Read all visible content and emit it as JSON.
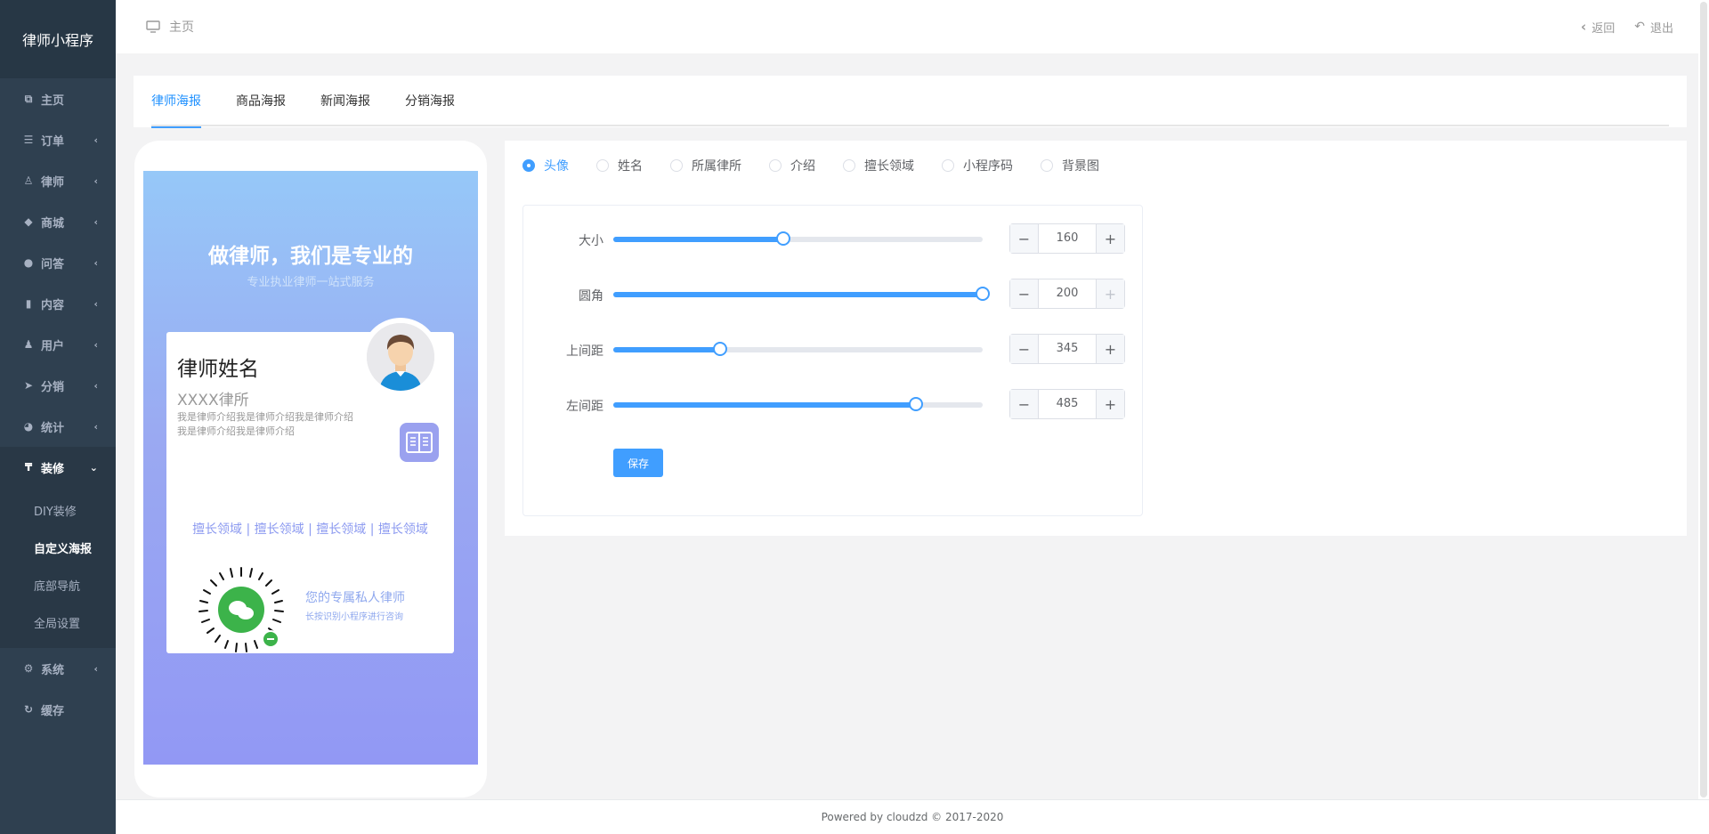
{
  "app": {
    "title": "律师小程序"
  },
  "sidebar": {
    "items": [
      {
        "label": "主页",
        "icon": "copy-icon"
      },
      {
        "label": "订单",
        "icon": "list-icon"
      },
      {
        "label": "律师",
        "icon": "user-icon"
      },
      {
        "label": "商城",
        "icon": "tags-icon"
      },
      {
        "label": "问答",
        "icon": "comment-icon"
      },
      {
        "label": "内容",
        "icon": "book-icon"
      },
      {
        "label": "用户",
        "icon": "person-icon"
      },
      {
        "label": "分销",
        "icon": "send-icon"
      },
      {
        "label": "统计",
        "icon": "pie-chart-icon"
      },
      {
        "label": "装修",
        "icon": "paint-icon"
      },
      {
        "label": "系统",
        "icon": "gear-icon"
      },
      {
        "label": "缓存",
        "icon": "refresh-icon"
      }
    ],
    "sub_items": [
      {
        "label": "DIY装修"
      },
      {
        "label": "自定义海报"
      },
      {
        "label": "底部导航"
      },
      {
        "label": "全局设置"
      }
    ]
  },
  "header": {
    "breadcrumb": "主页",
    "back_label": "返回",
    "logout_label": "退出"
  },
  "tabs": [
    {
      "label": "律师海报",
      "active": true
    },
    {
      "label": "商品海报"
    },
    {
      "label": "新闻海报"
    },
    {
      "label": "分销海报"
    }
  ],
  "poster": {
    "title": "做律师，我们是专业的",
    "subtitle": "专业执业律师一站式服务",
    "name": "律师姓名",
    "firm": "XXXX律所",
    "intro": "我是律师介绍我是律师介绍我是律师介绍我是律师介绍我是律师介绍",
    "fields": "擅长领域 | 擅长领域 | 擅长领域 | 擅长领域",
    "tagline": "您的专属私人律师",
    "tagline_sub": "长按识别小程序进行咨询"
  },
  "element_options": [
    {
      "label": "头像",
      "checked": true
    },
    {
      "label": "姓名"
    },
    {
      "label": "所属律所"
    },
    {
      "label": "介绍"
    },
    {
      "label": "擅长领域"
    },
    {
      "label": "小程序码"
    },
    {
      "label": "背景图"
    }
  ],
  "settings": [
    {
      "label": "大小",
      "value": "160",
      "level": 0.46
    },
    {
      "label": "圆角",
      "value": "200",
      "level": 1.0,
      "plus_disabled": true
    },
    {
      "label": "上间距",
      "value": "345",
      "level": 0.29
    },
    {
      "label": "左间距",
      "value": "485",
      "level": 0.82
    }
  ],
  "save_label": "保存",
  "footer": {
    "text": "Powered by cloudzd © 2017-2020"
  },
  "colors": {
    "accent": "#409eff",
    "sidebar_bg": "#2f4050",
    "poster_top": "#96c8f8",
    "poster_bottom": "#9298f4"
  }
}
